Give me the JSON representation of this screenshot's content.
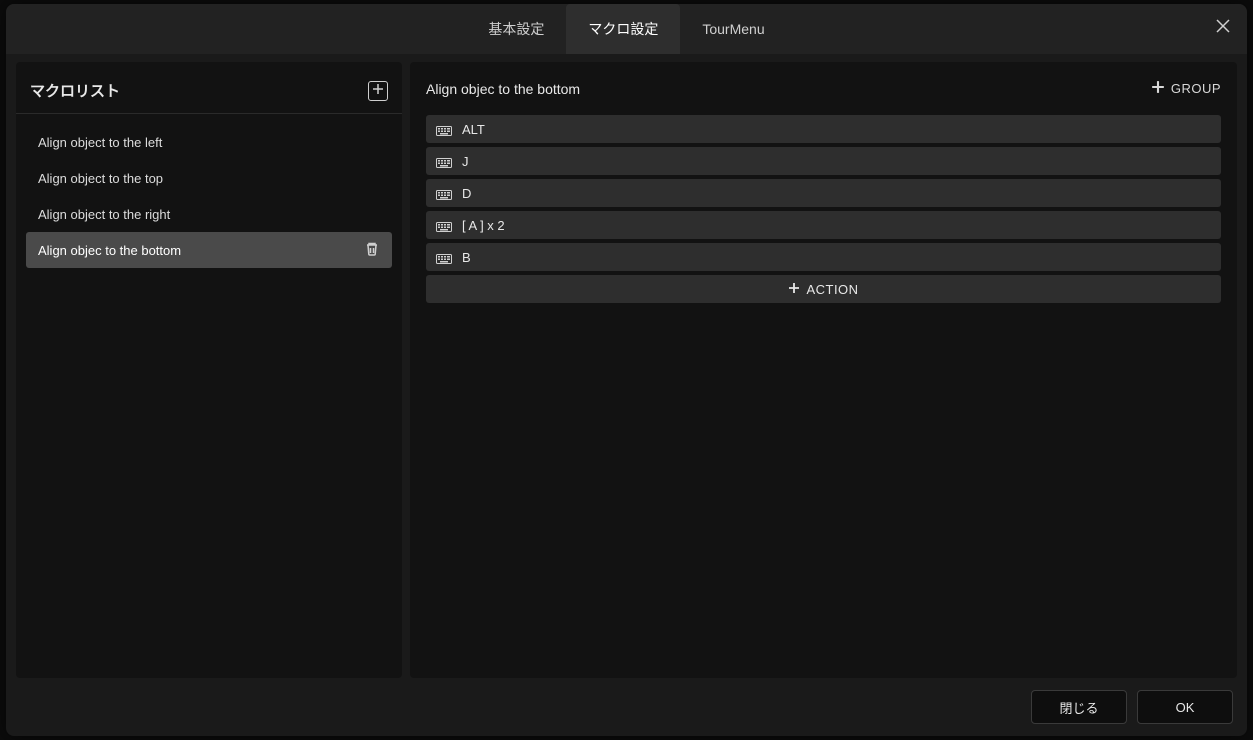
{
  "tabs": {
    "basic": "基本設定",
    "macro": "マクロ設定",
    "tour": "TourMenu"
  },
  "sidebar": {
    "title": "マクロリスト",
    "items": [
      {
        "label": "Align object to the left",
        "selected": false
      },
      {
        "label": "Align object to the top",
        "selected": false
      },
      {
        "label": "Align object to the right",
        "selected": false
      },
      {
        "label": "Align objec to the bottom",
        "selected": true
      }
    ]
  },
  "detail": {
    "title": "Align objec to the bottom",
    "group_label": "GROUP",
    "actions": [
      {
        "label": "ALT"
      },
      {
        "label": "J"
      },
      {
        "label": "D"
      },
      {
        "label": "[ A ] x 2"
      },
      {
        "label": "B"
      }
    ],
    "add_action_label": "ACTION"
  },
  "footer": {
    "close": "閉じる",
    "ok": "OK"
  }
}
